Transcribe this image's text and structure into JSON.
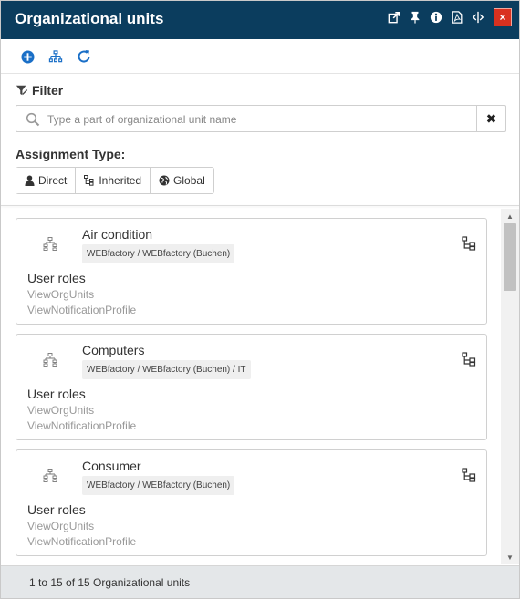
{
  "header": {
    "title": "Organizational units",
    "icons": [
      "export-icon",
      "pin-icon",
      "info-icon",
      "pdf-icon",
      "resize-icon",
      "close-icon"
    ],
    "bg_color": "#0b3d5e",
    "close_color": "#d9311f",
    "close_label": "×"
  },
  "toolbar": {
    "icons": [
      "add-icon",
      "hierarchy-icon",
      "refresh-icon"
    ],
    "accent": "#1a6fc7"
  },
  "filter": {
    "label": "Filter",
    "search_placeholder": "Type a part of organizational unit name",
    "search_value": "",
    "clear_label": "✖"
  },
  "assignment": {
    "label": "Assignment Type:",
    "options": [
      {
        "label": "Direct",
        "icon": "user-icon"
      },
      {
        "label": "Inherited",
        "icon": "hierarchy-icon"
      },
      {
        "label": "Global",
        "icon": "globe-icon"
      }
    ]
  },
  "units": [
    {
      "name": "Air condition",
      "path": "WEBfactory / WEBfactory (Buchen)",
      "roles_label": "User roles",
      "roles": [
        "ViewOrgUnits",
        "ViewNotificationProfile"
      ]
    },
    {
      "name": "Computers",
      "path": "WEBfactory / WEBfactory (Buchen) / IT",
      "roles_label": "User roles",
      "roles": [
        "ViewOrgUnits",
        "ViewNotificationProfile"
      ]
    },
    {
      "name": "Consumer",
      "path": "WEBfactory / WEBfactory (Buchen)",
      "roles_label": "User roles",
      "roles": [
        "ViewOrgUnits",
        "ViewNotificationProfile"
      ]
    }
  ],
  "footer": {
    "text": "1 to 15 of 15 Organizational units"
  }
}
